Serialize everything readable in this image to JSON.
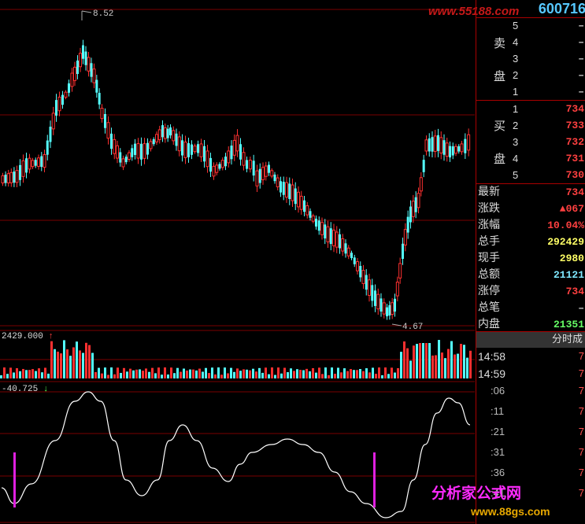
{
  "stock_code": "600716",
  "watermark_top": "www.55188.com",
  "watermark_bottom": "分析家公式网",
  "watermark_bottom_url": "www.88gs.com",
  "price_chart": {
    "high_label": "8.52",
    "low_label": "4.67"
  },
  "volume_label": "2429.000",
  "indicator_label": "-40.725",
  "order_book": {
    "sell_label_1": "卖",
    "sell_label_2": "盘",
    "buy_label_1": "买",
    "buy_label_2": "盘",
    "sell": [
      {
        "level": "5",
        "price": "–"
      },
      {
        "level": "4",
        "price": "–"
      },
      {
        "level": "3",
        "price": "–"
      },
      {
        "level": "2",
        "price": "–"
      },
      {
        "level": "1",
        "price": "–"
      }
    ],
    "buy": [
      {
        "level": "1",
        "price": "734"
      },
      {
        "level": "2",
        "price": "733"
      },
      {
        "level": "3",
        "price": "732"
      },
      {
        "level": "4",
        "price": "731"
      },
      {
        "level": "5",
        "price": "730"
      }
    ]
  },
  "quote": [
    {
      "label": "最新",
      "value": "734",
      "color": "#ff4040"
    },
    {
      "label": "涨跌",
      "value": "▲067",
      "color": "#ff4040"
    },
    {
      "label": "涨幅",
      "value": "10.04%",
      "color": "#ff4040"
    },
    {
      "label": "总手",
      "value": "292429",
      "color": "#ffff66"
    },
    {
      "label": "现手",
      "value": "2980",
      "color": "#ffff66"
    },
    {
      "label": "总额",
      "value": "21121",
      "color": "#7fe8ff"
    },
    {
      "label": "涨停",
      "value": "734",
      "color": "#ff4040"
    },
    {
      "label": "总笔",
      "value": "–",
      "color": "#ccc"
    },
    {
      "label": "内盘",
      "value": "21351",
      "color": "#66ff66"
    }
  ],
  "trades_header": "分时成",
  "trades": [
    {
      "time": "14:58",
      "value": "7"
    },
    {
      "time": "14:59",
      "value": "7"
    },
    {
      "time": ":06",
      "value": "7"
    },
    {
      "time": ":11",
      "value": "7"
    },
    {
      "time": ":21",
      "value": "7"
    },
    {
      "time": ":31",
      "value": "7"
    },
    {
      "time": ":36",
      "value": "7"
    },
    {
      "time": ":41",
      "value": "7"
    }
  ]
}
